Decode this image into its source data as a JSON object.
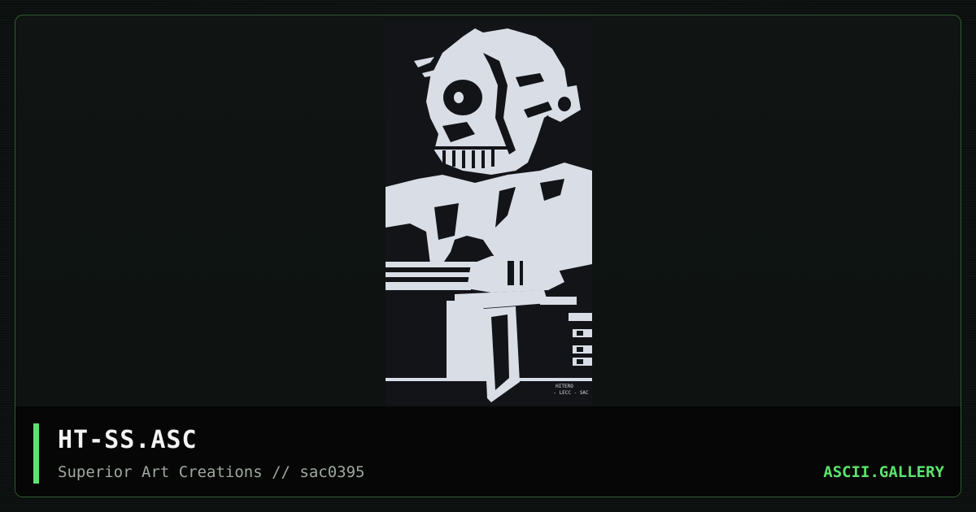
{
  "artwork": {
    "file_title": "HT-SS.ASC",
    "subtitle": "Superior Art Creations // sac0395",
    "credit_line_1": "HITERO",
    "credit_line_2": "- LECC - SAC"
  },
  "brand": {
    "label": "ASCII.GALLERY",
    "accent_color": "#5ce36e"
  },
  "colors": {
    "background": "#0b0f0d",
    "frame_border": "#2f5a34",
    "art_light": "#d8dde6",
    "art_dark": "#121418",
    "title_text": "#f2f2f2",
    "subtitle_text": "#9fa89f"
  }
}
